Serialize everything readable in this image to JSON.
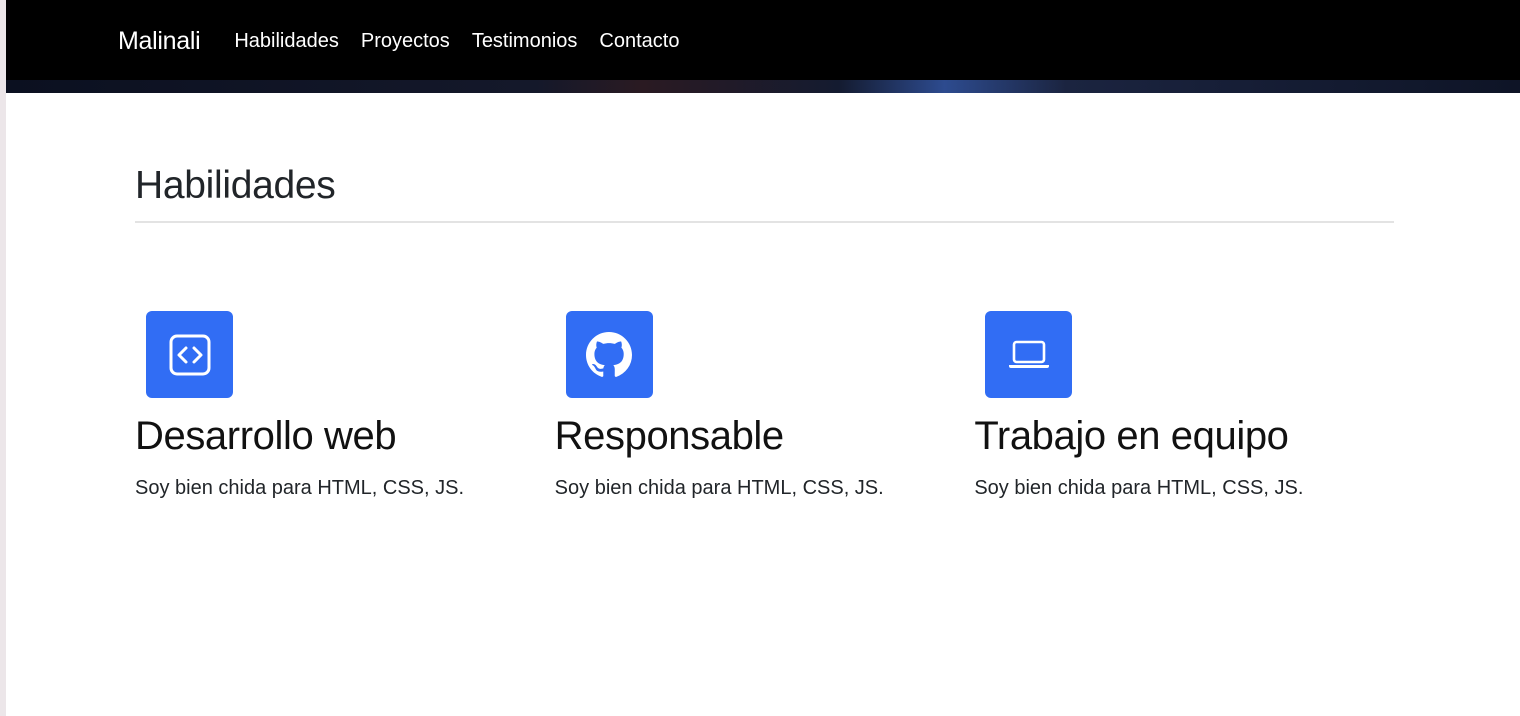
{
  "navbar": {
    "brand": "Malinali",
    "links": [
      "Habilidades",
      "Proyectos",
      "Testimonios",
      "Contacto"
    ]
  },
  "skills": {
    "title": "Habilidades",
    "items": [
      {
        "icon": "code-icon",
        "title": "Desarrollo web",
        "text": "Soy bien chida para HTML, CSS, JS."
      },
      {
        "icon": "github-icon",
        "title": "Responsable",
        "text": "Soy bien chida para HTML, CSS, JS."
      },
      {
        "icon": "laptop-icon",
        "title": "Trabajo en equipo",
        "text": "Soy bien chida para HTML, CSS, JS."
      }
    ]
  },
  "colors": {
    "navbar_bg": "#000000",
    "accent": "#316df4",
    "text": "#212529"
  }
}
